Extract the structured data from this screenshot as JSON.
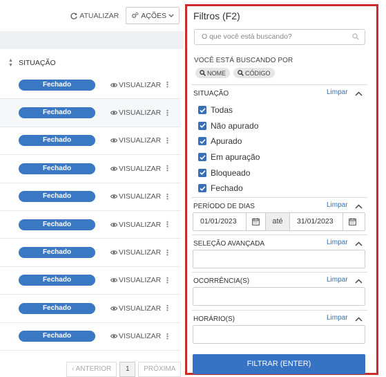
{
  "toolbar": {
    "refresh_label": "ATUALIZAR",
    "actions_label": "AÇÕES"
  },
  "table": {
    "column_header": "SITUAÇÃO",
    "rows": [
      {
        "status": "Fechado",
        "action": "VISUALIZAR"
      },
      {
        "status": "Fechado",
        "action": "VISUALIZAR"
      },
      {
        "status": "Fechado",
        "action": "VISUALIZAR"
      },
      {
        "status": "Fechado",
        "action": "VISUALIZAR"
      },
      {
        "status": "Fechado",
        "action": "VISUALIZAR"
      },
      {
        "status": "Fechado",
        "action": "VISUALIZAR"
      },
      {
        "status": "Fechado",
        "action": "VISUALIZAR"
      },
      {
        "status": "Fechado",
        "action": "VISUALIZAR"
      },
      {
        "status": "Fechado",
        "action": "VISUALIZAR"
      },
      {
        "status": "Fechado",
        "action": "VISUALIZAR"
      }
    ]
  },
  "pagination": {
    "prev_label": "ANTERIOR",
    "current_page": "1",
    "next_label": "PRÓXIMA"
  },
  "filters": {
    "title": "Filtros (F2)",
    "search_placeholder": "O que você está buscando?",
    "searching_for_label": "VOCÊ ESTÁ BUSCANDO POR",
    "chips": [
      "NOME",
      "CÓDIGO"
    ],
    "situacao": {
      "label": "SITUAÇÃO",
      "clear_label": "Limpar",
      "options": [
        {
          "label": "Todas",
          "checked": true
        },
        {
          "label": "Não apurado",
          "checked": true
        },
        {
          "label": "Apurado",
          "checked": true
        },
        {
          "label": "Em apuração",
          "checked": true
        },
        {
          "label": "Bloqueado",
          "checked": true
        },
        {
          "label": "Fechado",
          "checked": true
        }
      ]
    },
    "periodo": {
      "label": "PERÍODO DE DIAS",
      "clear_label": "Limpar",
      "start_date": "01/01/2023",
      "separator": "até",
      "end_date": "31/01/2023"
    },
    "selecao": {
      "label": "SELEÇÃO AVANÇADA",
      "clear_label": "Limpar",
      "value": ""
    },
    "ocorrencia": {
      "label": "OCORRÊNCIA(S)",
      "clear_label": "Limpar",
      "value": ""
    },
    "horario": {
      "label": "HORÁRIO(S)",
      "clear_label": "Limpar",
      "value": ""
    },
    "submit_label": "FILTRAR (ENTER)"
  },
  "colors": {
    "accent": "#3673c4",
    "badge": "#3a78c4",
    "panel_border": "#cc2b2b",
    "link": "#2f6fb3"
  }
}
